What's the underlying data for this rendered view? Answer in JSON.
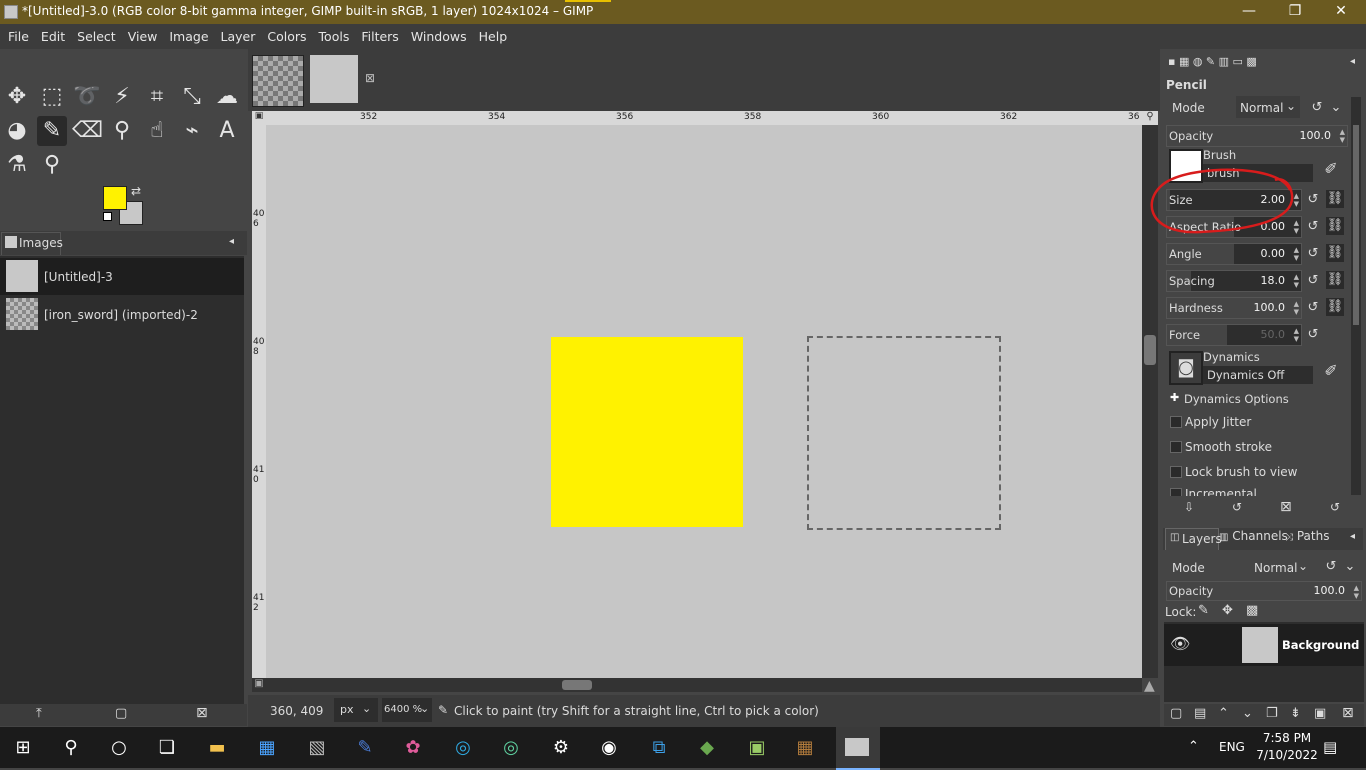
{
  "window": {
    "title": "*[Untitled]-3.0 (RGB color 8-bit gamma integer, GIMP built-in sRGB, 1 layer) 1024x1024 – GIMP",
    "minimize": "—",
    "restore": "❐",
    "close": "✕"
  },
  "menu": [
    "File",
    "Edit",
    "Select",
    "View",
    "Image",
    "Layer",
    "Colors",
    "Tools",
    "Filters",
    "Windows",
    "Help"
  ],
  "colors": {
    "foreground": "#fff200",
    "background": "#c8c8c8",
    "accent": "#fff200"
  },
  "images_panel": {
    "tab": "Images",
    "items": [
      "[Untitled]-3",
      "[iron_sword] (imported)-2"
    ]
  },
  "ruler": {
    "h_ticks": [
      "352",
      "354",
      "356",
      "358",
      "360",
      "362",
      "36"
    ],
    "v_ticks": [
      "406",
      "408",
      "410",
      "412"
    ]
  },
  "status": {
    "coords": "360, 409",
    "unit": "px",
    "zoom": "6400 %",
    "message": "Click to paint (try Shift for a straight line, Ctrl to pick a color)"
  },
  "tool_options": {
    "title": "Pencil",
    "mode_label": "Mode",
    "mode_value": "Normal",
    "opacity_label": "Opacity",
    "opacity_value": "100.0",
    "brush_label": "Brush",
    "brush_value": "brush",
    "sliders": [
      {
        "name": "Size",
        "value": "2.00",
        "fill": 0.02
      },
      {
        "name": "Aspect Ratio",
        "value": "0.00",
        "fill": 0.5
      },
      {
        "name": "Angle",
        "value": "0.00",
        "fill": 0.5
      },
      {
        "name": "Spacing",
        "value": "18.0",
        "fill": 0.18
      },
      {
        "name": "Hardness",
        "value": "100.0",
        "fill": 1.0
      },
      {
        "name": "Force",
        "value": "50.0",
        "fill": 0.5
      }
    ],
    "dynamics_label": "Dynamics",
    "dynamics_value": "Dynamics Off",
    "dynamics_options": "Dynamics Options",
    "checks": [
      "Apply Jitter",
      "Smooth stroke",
      "Lock brush to view",
      "Incremental"
    ]
  },
  "layers_panel": {
    "tabs": [
      "Layers",
      "Channels",
      "Paths"
    ],
    "mode_label": "Mode",
    "mode_value": "Normal",
    "opacity_label": "Opacity",
    "opacity_value": "100.0",
    "lock_label": "Lock:",
    "layer_name": "Background"
  },
  "taskbar": {
    "time": "7:58 PM",
    "date": "7/10/2022",
    "lang": "ENG"
  }
}
